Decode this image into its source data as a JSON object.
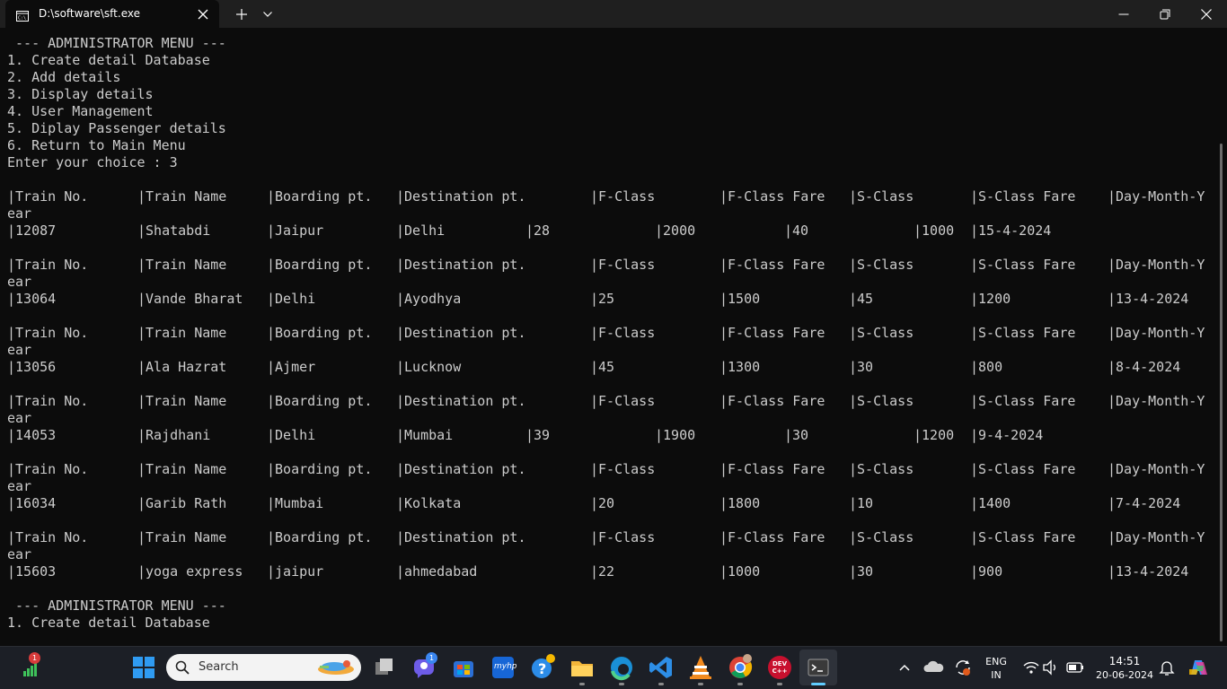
{
  "window": {
    "tab_title": "D:\\software\\sft.exe"
  },
  "console": {
    "menu_header": " --- ADMINISTRATOR MENU ---",
    "menu_items": [
      "1. Create detail Database",
      "2. Add details",
      "3. Display details",
      "4. User Management",
      "5. Diplay Passenger details",
      "6. Return to Main Menu"
    ],
    "prompt": "Enter your choice : 3",
    "table_headers": [
      "|Train No.",
      "|Train Name",
      "|Boarding pt.",
      "|Destination pt.",
      "|F-Class",
      "|F-Class Fare",
      "|S-Class",
      "|S-Class Fare",
      "|Day-Month-Y"
    ],
    "header_wrap": "ear",
    "records": [
      [
        "|12087",
        "|Shatabdi",
        "|Jaipur",
        "|Delhi",
        "|28",
        "|2000",
        "|40",
        "|1000",
        "|15-4-2024"
      ],
      [
        "|13064",
        "|Vande Bharat",
        "|Delhi",
        "|Ayodhya",
        "|25",
        "|1500",
        "|45",
        "|1200",
        "|13-4-2024"
      ],
      [
        "|13056",
        "|Ala Hazrat",
        "|Ajmer",
        "|Lucknow",
        "|45",
        "|1300",
        "|30",
        "|800",
        "|8-4-2024"
      ],
      [
        "|14053",
        "|Rajdhani",
        "|Delhi",
        "|Mumbai",
        "|39",
        "|1900",
        "|30",
        "|1200",
        "|9-4-2024"
      ],
      [
        "|16034",
        "|Garib Rath",
        "|Mumbai",
        "|Kolkata",
        "|20",
        "|1800",
        "|10",
        "|1400",
        "|7-4-2024"
      ],
      [
        "|15603",
        "|yoga express",
        "|jaipur",
        "|ahmedabad",
        "|22",
        "|1000",
        "|30",
        "|900",
        "|13-4-2024"
      ]
    ],
    "menu_header_repeat": " --- ADMINISTRATOR MENU ---",
    "menu_item_repeat": "1. Create detail Database"
  },
  "taskbar": {
    "search_placeholder": "Search",
    "widgets_badge": "1",
    "chat_badge": "1",
    "language_line1": "ENG",
    "language_line2": "IN",
    "time": "14:51",
    "date": "20-06-2024",
    "devcpp_label": "DEV C++",
    "myhp_label": "myhp",
    "accent_color": "#60cdff"
  }
}
